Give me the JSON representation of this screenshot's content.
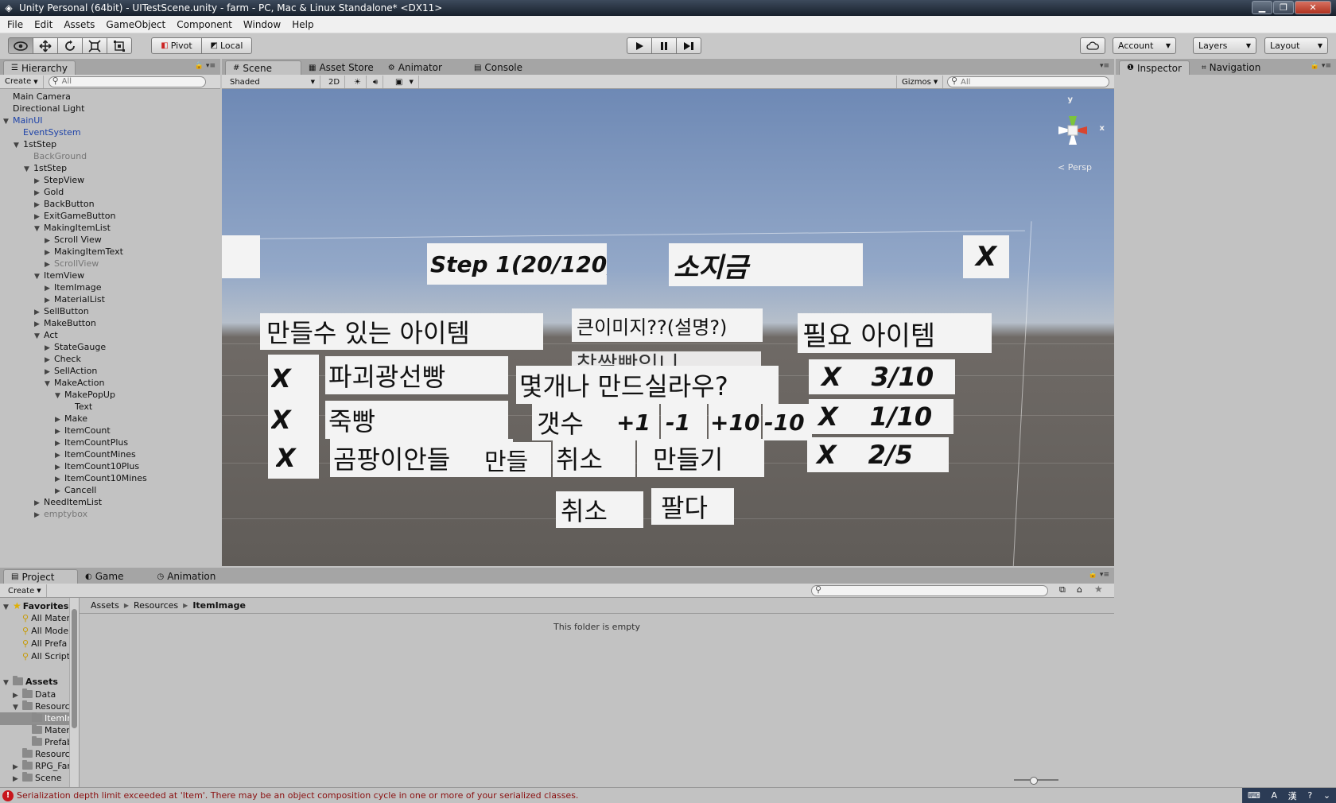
{
  "window": {
    "title": "Unity Personal (64bit) - UITestScene.unity - farm - PC, Mac & Linux Standalone* <DX11>",
    "minimize": "▁",
    "maximize": "❐",
    "close": "✕"
  },
  "menu": [
    "File",
    "Edit",
    "Assets",
    "GameObject",
    "Component",
    "Window",
    "Help"
  ],
  "toolbar": {
    "pivot_label": "Pivot",
    "local_label": "Local",
    "account_label": "Account",
    "layers_label": "Layers",
    "layout_label": "Layout"
  },
  "hierarchy": {
    "tab_label": "Hierarchy",
    "create_label": "Create",
    "search_placeholder": "All",
    "rows": [
      {
        "label": "Main Camera",
        "indent": 0,
        "arrow": "",
        "style": ""
      },
      {
        "label": "Directional Light",
        "indent": 0,
        "arrow": "",
        "style": ""
      },
      {
        "label": "MainUI",
        "indent": 0,
        "arrow": "▼",
        "style": "blue"
      },
      {
        "label": "EventSystem",
        "indent": 1,
        "arrow": "",
        "style": "blue"
      },
      {
        "label": "1stStep",
        "indent": 1,
        "arrow": "▼",
        "style": ""
      },
      {
        "label": "BackGround",
        "indent": 2,
        "arrow": "",
        "style": "gray"
      },
      {
        "label": "1stStep",
        "indent": 2,
        "arrow": "▼",
        "style": ""
      },
      {
        "label": "StepView",
        "indent": 3,
        "arrow": "▶",
        "style": ""
      },
      {
        "label": "Gold",
        "indent": 3,
        "arrow": "▶",
        "style": ""
      },
      {
        "label": "BackButton",
        "indent": 3,
        "arrow": "▶",
        "style": ""
      },
      {
        "label": "ExitGameButton",
        "indent": 3,
        "arrow": "▶",
        "style": ""
      },
      {
        "label": "MakingItemList",
        "indent": 3,
        "arrow": "▼",
        "style": ""
      },
      {
        "label": "Scroll View",
        "indent": 4,
        "arrow": "▶",
        "style": ""
      },
      {
        "label": "MakingItemText",
        "indent": 4,
        "arrow": "▶",
        "style": ""
      },
      {
        "label": "ScrollView",
        "indent": 4,
        "arrow": "▶",
        "style": "gray"
      },
      {
        "label": "ItemView",
        "indent": 3,
        "arrow": "▼",
        "style": ""
      },
      {
        "label": "ItemImage",
        "indent": 4,
        "arrow": "▶",
        "style": ""
      },
      {
        "label": "MaterialList",
        "indent": 4,
        "arrow": "▶",
        "style": ""
      },
      {
        "label": "SellButton",
        "indent": 3,
        "arrow": "▶",
        "style": ""
      },
      {
        "label": "MakeButton",
        "indent": 3,
        "arrow": "▶",
        "style": ""
      },
      {
        "label": "Act",
        "indent": 3,
        "arrow": "▼",
        "style": ""
      },
      {
        "label": "StateGauge",
        "indent": 4,
        "arrow": "▶",
        "style": ""
      },
      {
        "label": "Check",
        "indent": 4,
        "arrow": "▶",
        "style": ""
      },
      {
        "label": "SellAction",
        "indent": 4,
        "arrow": "▶",
        "style": ""
      },
      {
        "label": "MakeAction",
        "indent": 4,
        "arrow": "▼",
        "style": ""
      },
      {
        "label": "MakePopUp",
        "indent": 5,
        "arrow": "▼",
        "style": ""
      },
      {
        "label": "Text",
        "indent": 6,
        "arrow": "",
        "style": ""
      },
      {
        "label": "Make",
        "indent": 5,
        "arrow": "▶",
        "style": ""
      },
      {
        "label": "ItemCount",
        "indent": 5,
        "arrow": "▶",
        "style": ""
      },
      {
        "label": "ItemCountPlus",
        "indent": 5,
        "arrow": "▶",
        "style": ""
      },
      {
        "label": "ItemCountMines",
        "indent": 5,
        "arrow": "▶",
        "style": ""
      },
      {
        "label": "ItemCount10Plus",
        "indent": 5,
        "arrow": "▶",
        "style": ""
      },
      {
        "label": "ItemCount10Mines",
        "indent": 5,
        "arrow": "▶",
        "style": ""
      },
      {
        "label": "Cancell",
        "indent": 5,
        "arrow": "▶",
        "style": ""
      },
      {
        "label": "NeedItemList",
        "indent": 3,
        "arrow": "▶",
        "style": ""
      },
      {
        "label": "emptybox",
        "indent": 3,
        "arrow": "▶",
        "style": "gray"
      }
    ]
  },
  "scene": {
    "tabs": [
      {
        "label": "Scene",
        "icon": "#"
      },
      {
        "label": "Asset Store",
        "icon": "▦"
      },
      {
        "label": "Animator",
        "icon": "⚙"
      },
      {
        "label": "Console",
        "icon": "▤"
      }
    ],
    "shading_mode": "Shaded",
    "mode_2d": "2D",
    "gizmos_label": "Gizmos",
    "search_placeholder": "All",
    "persp_label": "< Persp",
    "gizmo_y": "y",
    "gizmo_x": "x"
  },
  "scene_ui": {
    "step": "Step 1(20/120)",
    "gold": "소지금",
    "exit": "X",
    "making_list_title": "만들수 있는 아이템",
    "item_image_text": "큰이미지??(설명?)",
    "need_title": "필요 아이템",
    "make_rows": [
      {
        "x": "X",
        "name": "파괴광선빵"
      },
      {
        "x": "X",
        "name": "죽빵"
      },
      {
        "x": "X",
        "name": "곰팡이안들"
      }
    ],
    "need_rows": [
      {
        "x": "X",
        "count": "3/10"
      },
      {
        "x": "X",
        "count": "1/10"
      },
      {
        "x": "X",
        "count": "2/5"
      }
    ],
    "popup_question": "몇개나 만드실라우?",
    "popup_partial": "찹쌀빵임니",
    "count_label": "갯수",
    "plus1": "+1",
    "minus1": "-1",
    "plus10": "+10",
    "minus10": "-10",
    "make_short": "만들",
    "cancel": "취소",
    "make": "만들기",
    "cancel2": "취소",
    "sell": "팔다"
  },
  "inspector": {
    "tabs": [
      {
        "label": "Inspector",
        "icon": "❶"
      },
      {
        "label": "Navigation",
        "icon": "⌗"
      }
    ]
  },
  "bottom_tabs": [
    {
      "label": "Project",
      "icon": "▤"
    },
    {
      "label": "Game",
      "icon": "◐"
    },
    {
      "label": "Animation",
      "icon": "◷"
    }
  ],
  "project": {
    "create_label": "Create",
    "favorites": {
      "title": "Favorites",
      "items": [
        "All Mater",
        "All Mode",
        "All Prefa",
        "All Script"
      ]
    },
    "assets": {
      "title": "Assets",
      "items": [
        {
          "label": "Data",
          "indent": 1,
          "arrow": "▶",
          "selected": false
        },
        {
          "label": "Resource",
          "indent": 1,
          "arrow": "▼",
          "selected": false
        },
        {
          "label": "ItemIr",
          "indent": 2,
          "arrow": "",
          "selected": true
        },
        {
          "label": "Materi",
          "indent": 2,
          "arrow": "",
          "selected": false
        },
        {
          "label": "Prefab",
          "indent": 2,
          "arrow": "",
          "selected": false
        },
        {
          "label": "Resource",
          "indent": 1,
          "arrow": "",
          "selected": false
        },
        {
          "label": "RPG_Far",
          "indent": 1,
          "arrow": "▶",
          "selected": false
        },
        {
          "label": "Scene",
          "indent": 1,
          "arrow": "▶",
          "selected": false
        }
      ]
    },
    "breadcrumb": [
      "Assets",
      "Resources",
      "ItemImage"
    ],
    "empty_message": "This folder is empty"
  },
  "status": {
    "message": "Serialization depth limit exceeded at 'Item'. There may be an object composition cycle in one or more of your serialized classes.",
    "tray_items": [
      "A",
      "漢",
      "?"
    ]
  },
  "colors": {
    "error_red": "#c8161d",
    "link_blue": "#1d42a8",
    "scene_sky": "#6e89b5",
    "scene_ground": "#605c58"
  }
}
